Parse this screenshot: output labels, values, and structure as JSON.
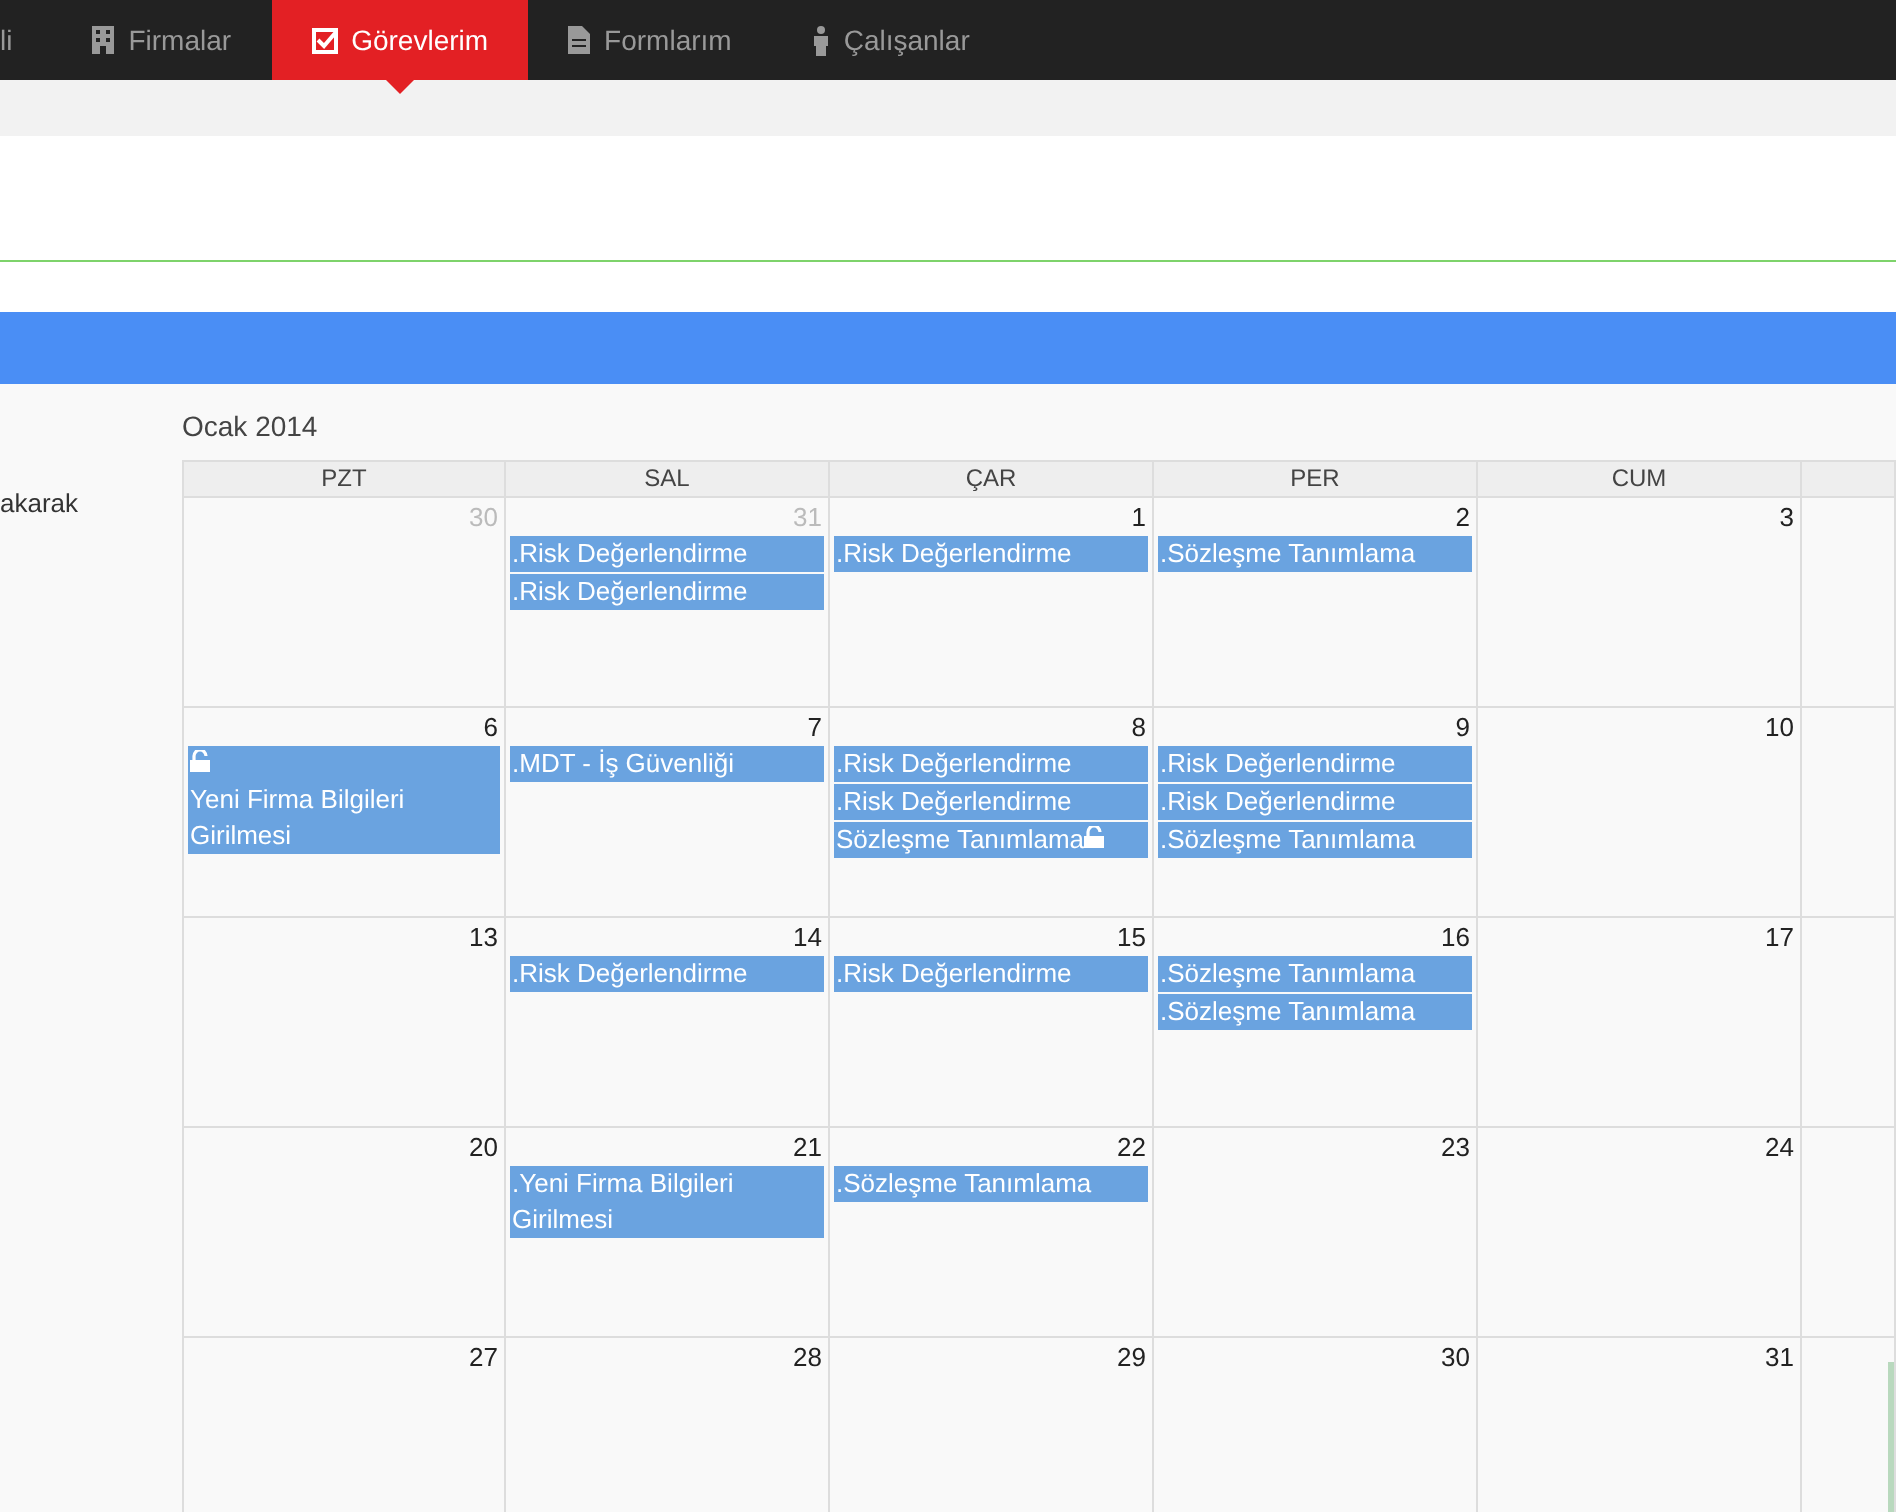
{
  "nav": [
    {
      "label": "li",
      "selected": false
    },
    {
      "label": "Firmalar",
      "selected": false
    },
    {
      "label": "Görevlerim",
      "selected": true
    },
    {
      "label": "Formlarım",
      "selected": false
    },
    {
      "label": "Çalışanlar",
      "selected": false
    }
  ],
  "side_text": "akarak",
  "calendar": {
    "title": "Ocak 2014",
    "columns": [
      "PZT",
      "SAL",
      "ÇAR",
      "PER",
      "CUM"
    ],
    "weeks": [
      [
        {
          "day": "30",
          "muted": true
        },
        {
          "day": "31",
          "muted": true,
          "events": [
            {
              "label": ".Risk Değerlendirme",
              "kind": "plain"
            },
            {
              "label": ".Risk Değerlendirme",
              "kind": "plain"
            }
          ]
        },
        {
          "day": "1",
          "muted": false,
          "events": [
            {
              "label": ".Risk Değerlendirme",
              "kind": "plain"
            }
          ]
        },
        {
          "day": "2",
          "muted": false,
          "events": [
            {
              "label": ".Sözleşme Tanımlama",
              "kind": "plain"
            }
          ]
        },
        {
          "day": "3",
          "muted": false
        }
      ],
      [
        {
          "day": "6",
          "muted": false,
          "events": [
            {
              "label": "Yeni Firma Bilgileri Girilmesi",
              "kind": "lock-above"
            }
          ]
        },
        {
          "day": "7",
          "muted": false,
          "events": [
            {
              "label": ".MDT - İş Güvenliği",
              "kind": "plain"
            }
          ]
        },
        {
          "day": "8",
          "muted": false,
          "events": [
            {
              "label": ".Risk Değerlendirme",
              "kind": "plain"
            },
            {
              "label": ".Risk Değerlendirme",
              "kind": "plain"
            },
            {
              "label": "Sözleşme Tanımlama",
              "kind": "lock-after"
            }
          ]
        },
        {
          "day": "9",
          "muted": false,
          "events": [
            {
              "label": ".Risk Değerlendirme",
              "kind": "plain"
            },
            {
              "label": ".Risk Değerlendirme",
              "kind": "plain"
            },
            {
              "label": ".Sözleşme Tanımlama",
              "kind": "plain"
            }
          ]
        },
        {
          "day": "10",
          "muted": false
        }
      ],
      [
        {
          "day": "13",
          "muted": false
        },
        {
          "day": "14",
          "muted": false,
          "events": [
            {
              "label": ".Risk Değerlendirme",
              "kind": "plain"
            }
          ]
        },
        {
          "day": "15",
          "muted": false,
          "events": [
            {
              "label": ".Risk Değerlendirme",
              "kind": "plain"
            }
          ]
        },
        {
          "day": "16",
          "muted": false,
          "events": [
            {
              "label": ".Sözleşme Tanımlama",
              "kind": "plain"
            },
            {
              "label": ".Sözleşme Tanımlama",
              "kind": "plain"
            }
          ]
        },
        {
          "day": "17",
          "muted": false
        }
      ],
      [
        {
          "day": "20",
          "muted": false
        },
        {
          "day": "21",
          "muted": false,
          "events": [
            {
              "label": ".Yeni Firma Bilgileri Girilmesi",
              "kind": "plain"
            }
          ]
        },
        {
          "day": "22",
          "muted": false,
          "events": [
            {
              "label": ".Sözleşme Tanımlama",
              "kind": "plain"
            }
          ]
        },
        {
          "day": "23",
          "muted": false
        },
        {
          "day": "24",
          "muted": false
        }
      ],
      [
        {
          "day": "27",
          "muted": false
        },
        {
          "day": "28",
          "muted": false
        },
        {
          "day": "29",
          "muted": false
        },
        {
          "day": "30",
          "muted": false
        },
        {
          "day": "31",
          "muted": false
        },
        {
          "marked": true
        }
      ]
    ]
  }
}
